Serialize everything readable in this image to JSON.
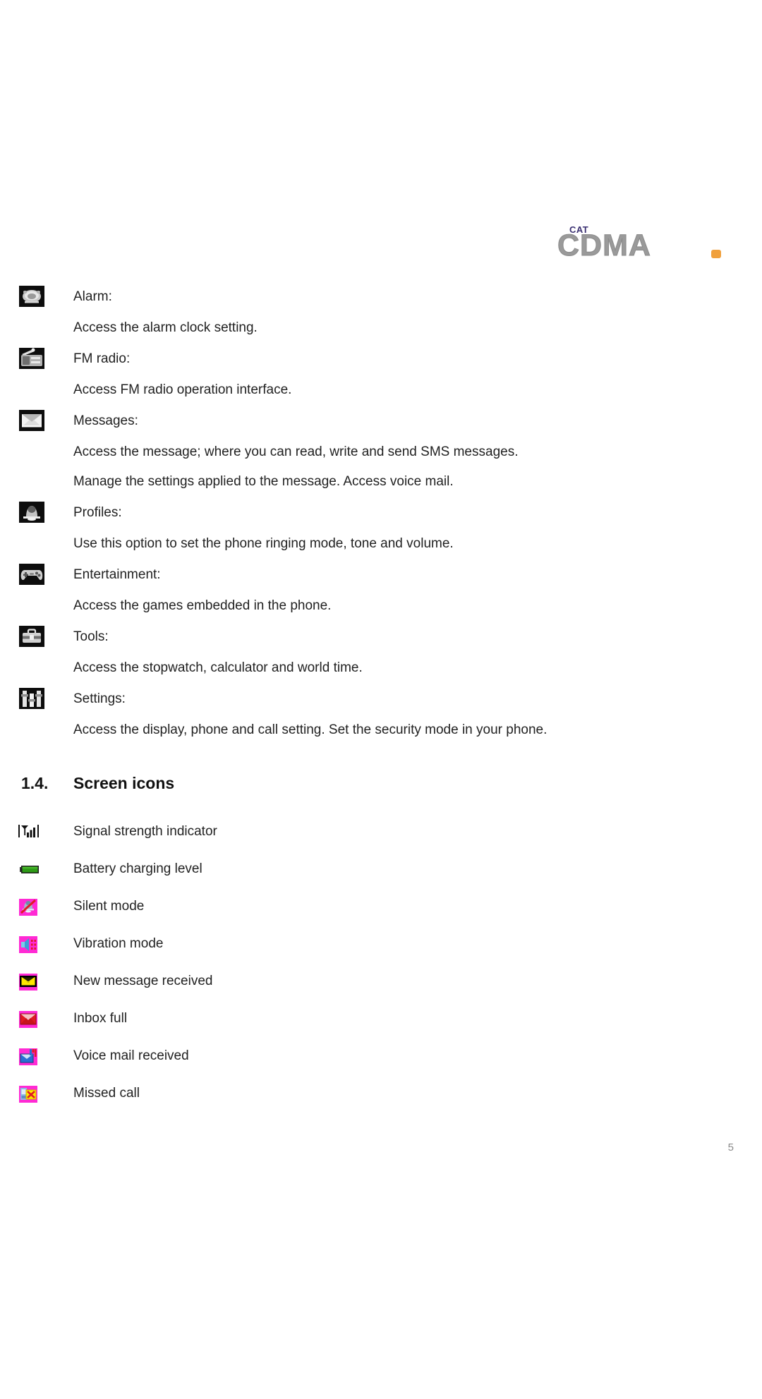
{
  "document": {
    "page_number": "5",
    "logo": {
      "top_text": "CAT",
      "main_text": "CDMA",
      "accent_color": "#f0a03c",
      "main_color": "#9a9a9a",
      "top_color": "#3b3172"
    }
  },
  "menu_entries": [
    {
      "icon": "alarm-clock-icon",
      "title": "Alarm:",
      "descriptions": [
        "Access the alarm clock setting."
      ]
    },
    {
      "icon": "fm-radio-icon",
      "title": "FM radio:",
      "descriptions": [
        "Access FM radio operation interface."
      ]
    },
    {
      "icon": "envelope-icon",
      "title": "Messages:",
      "descriptions": [
        "Access the message; where you can read, write and send SMS messages.",
        "Manage the settings applied to the message. Access voice mail."
      ]
    },
    {
      "icon": "profiles-bell-icon",
      "title": "Profiles:",
      "descriptions": [
        "Use this option to set the phone ringing mode, tone and volume."
      ]
    },
    {
      "icon": "gamepad-icon",
      "title": "Entertainment:",
      "descriptions": [
        "Access the games embedded in the phone."
      ]
    },
    {
      "icon": "toolbox-icon",
      "title": "Tools:",
      "descriptions": [
        "Access the stopwatch, calculator and world time."
      ]
    },
    {
      "icon": "settings-sliders-icon",
      "title": "Settings:",
      "descriptions": [
        "Access the display, phone and call setting. Set the security mode in your phone."
      ]
    }
  ],
  "section": {
    "number": "1.4.",
    "title": "Screen icons"
  },
  "screen_icons": [
    {
      "icon": "signal-strength-icon",
      "label": "Signal strength indicator"
    },
    {
      "icon": "battery-icon",
      "label": "Battery charging level"
    },
    {
      "icon": "silent-mode-icon",
      "label": "Silent mode"
    },
    {
      "icon": "vibration-mode-icon",
      "label": "Vibration mode"
    },
    {
      "icon": "new-message-icon",
      "label": "New message received"
    },
    {
      "icon": "inbox-full-icon",
      "label": "Inbox full"
    },
    {
      "icon": "voice-mail-icon",
      "label": "Voice mail received"
    },
    {
      "icon": "missed-call-icon",
      "label": "Missed call"
    }
  ],
  "colors": {
    "magenta": "#ff2ad4",
    "battery_green": "#2e9b17",
    "envelope_yellow": "#ffe600",
    "envelope_red": "#e01b24",
    "voice_blue": "#2a6fd4",
    "black": "#000000"
  }
}
